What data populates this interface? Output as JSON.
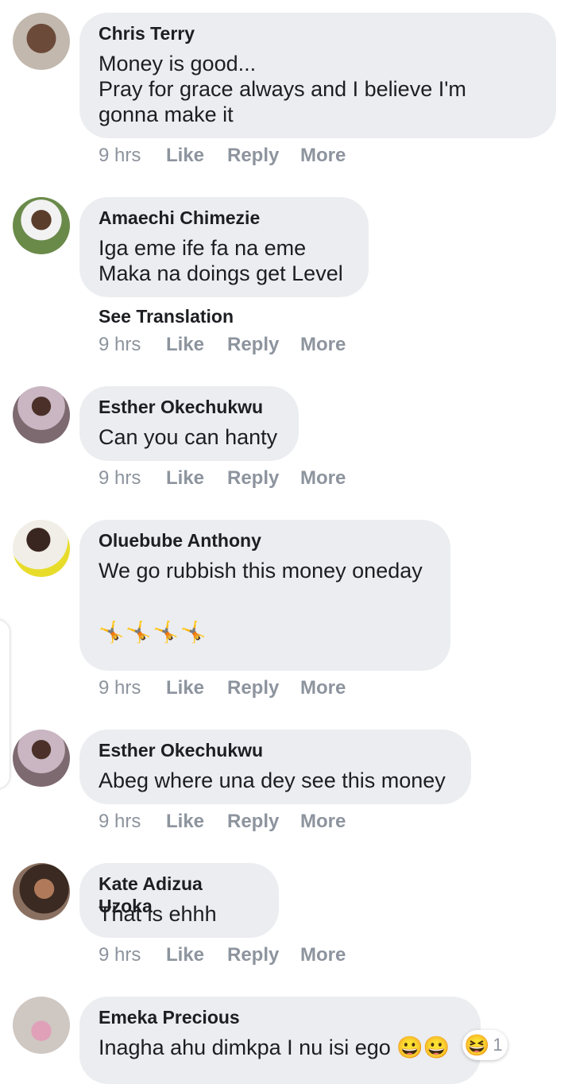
{
  "labels": {
    "like": "Like",
    "reply": "Reply",
    "more": "More"
  },
  "comments": [
    {
      "author": "Chris Terry",
      "text": "Money is good...\nPray for grace always and I believe I'm\ngonna make it",
      "time": "9 hrs",
      "avatar": "avatar-photo"
    },
    {
      "author": "Amaechi Chimezie",
      "text": "Iga eme ife fa na eme\nMaka na doings get Level",
      "time": "9 hrs",
      "see_translation": "See Translation",
      "avatar": "avatar-photo"
    },
    {
      "author": "Esther Okechukwu",
      "text": "Can you can hanty",
      "time": "9 hrs",
      "avatar": "avatar-photo"
    },
    {
      "author": "Oluebube Anthony",
      "text": "We go rubbish this money oneday",
      "emojis": "🤸🤸🤸🤸",
      "time": "9 hrs",
      "avatar": "avatar-photo"
    },
    {
      "author": "Esther Okechukwu",
      "text": "Abeg where una dey see this money",
      "time": "9 hrs",
      "avatar": "avatar-photo"
    },
    {
      "author": "Kate Adizua Uzoka",
      "text": "That is ehhh",
      "time": "9 hrs",
      "avatar": "avatar-photo"
    },
    {
      "author": "Emeka Precious",
      "text": "Inagha ahu dimkpa I nu isi ego 😀😀",
      "time": "",
      "reaction": {
        "emoji": "😆",
        "count": "1"
      },
      "avatar": "avatar-photo"
    }
  ]
}
